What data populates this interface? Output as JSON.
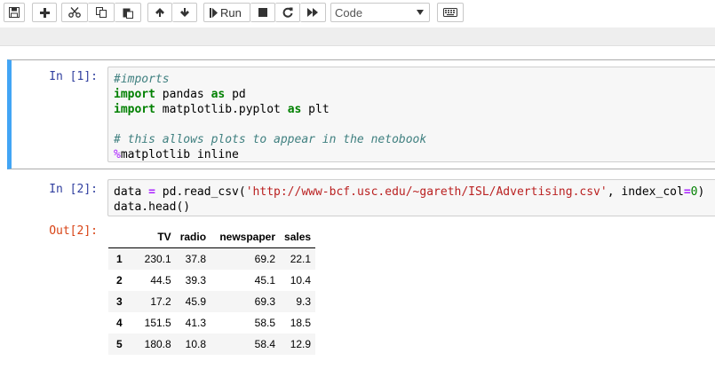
{
  "toolbar": {
    "run_label": "Run",
    "cell_type": "Code",
    "cell_type_options": [
      "Code"
    ]
  },
  "cells": {
    "c1": {
      "prompt": "In [1]:",
      "lines": [
        {
          "segments": [
            {
              "t": "#imports",
              "c": "cm"
            }
          ]
        },
        {
          "segments": [
            {
              "t": "import",
              "c": "kw"
            },
            {
              "t": " pandas ",
              "c": ""
            },
            {
              "t": "as",
              "c": "kw"
            },
            {
              "t": " pd",
              "c": ""
            }
          ]
        },
        {
          "segments": [
            {
              "t": "import",
              "c": "kw"
            },
            {
              "t": " matplotlib.pyplot ",
              "c": ""
            },
            {
              "t": "as",
              "c": "kw"
            },
            {
              "t": " plt",
              "c": ""
            }
          ]
        },
        {
          "segments": []
        },
        {
          "segments": [
            {
              "t": "# this allows plots to appear in the netobook",
              "c": "cm"
            }
          ]
        },
        {
          "segments": [
            {
              "t": "%",
              "c": "mg"
            },
            {
              "t": "matplotlib inline",
              "c": ""
            }
          ]
        }
      ]
    },
    "c2": {
      "prompt": "In [2]:",
      "out_prompt": "Out[2]:",
      "lines": [
        {
          "segments": [
            {
              "t": "data ",
              "c": ""
            },
            {
              "t": "=",
              "c": "op"
            },
            {
              "t": " pd.read_csv(",
              "c": ""
            },
            {
              "t": "'http://www-bcf.usc.edu/~gareth/ISL/Advertising.csv'",
              "c": "st"
            },
            {
              "t": ", index_col",
              "c": ""
            },
            {
              "t": "=",
              "c": "op"
            },
            {
              "t": "0",
              "c": "nm"
            },
            {
              "t": ")",
              "c": ""
            }
          ]
        },
        {
          "segments": [
            {
              "t": "data.head()",
              "c": ""
            }
          ]
        }
      ],
      "table": {
        "columns": [
          "",
          "TV",
          "radio",
          "newspaper",
          "sales"
        ],
        "rows": [
          {
            "index": "1",
            "TV": "230.1",
            "radio": "37.8",
            "newspaper": "69.2",
            "sales": "22.1"
          },
          {
            "index": "2",
            "TV": "44.5",
            "radio": "39.3",
            "newspaper": "45.1",
            "sales": "10.4"
          },
          {
            "index": "3",
            "TV": "17.2",
            "radio": "45.9",
            "newspaper": "69.3",
            "sales": "9.3"
          },
          {
            "index": "4",
            "TV": "151.5",
            "radio": "41.3",
            "newspaper": "58.5",
            "sales": "18.5"
          },
          {
            "index": "5",
            "TV": "180.8",
            "radio": "10.8",
            "newspaper": "58.4",
            "sales": "12.9"
          }
        ]
      }
    }
  },
  "icons": [
    "save-icon",
    "plus-icon",
    "cut-icon",
    "copy-icon",
    "paste-icon",
    "arrow-up-icon",
    "arrow-down-icon",
    "step-run-icon",
    "stop-icon",
    "restart-icon",
    "fast-forward-icon",
    "keyboard-icon",
    "dropdown-arrow-icon"
  ],
  "colors": {
    "selected_cell_border": "#42a5f5",
    "in_prompt": "#303f9f",
    "out_prompt": "#d84315"
  }
}
